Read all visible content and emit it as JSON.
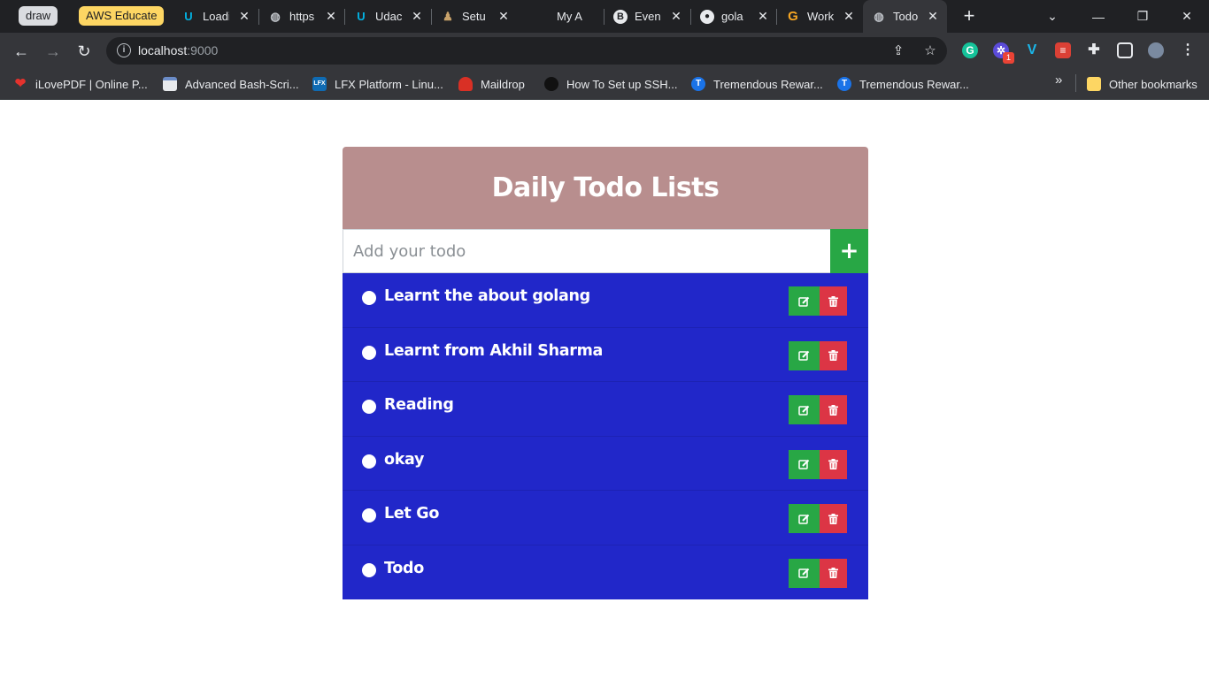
{
  "browser": {
    "tab_groups": [
      {
        "label": "draw",
        "color": "#dadce0"
      },
      {
        "label": "AWS Educate",
        "color": "#fdd663"
      }
    ],
    "tabs": [
      {
        "title": "Loadi",
        "icon": "udacity-icon"
      },
      {
        "title": "https",
        "icon": "globe-icon"
      },
      {
        "title": "Udac",
        "icon": "udacity-icon"
      },
      {
        "title": "Setu",
        "icon": "page-icon"
      },
      {
        "title": "My A",
        "icon": "blank-icon"
      },
      {
        "title": "Even",
        "icon": "b-logo-icon"
      },
      {
        "title": "gola",
        "icon": "github-icon"
      },
      {
        "title": "Work",
        "icon": "g-logo-icon"
      },
      {
        "title": "Todo",
        "icon": "globe-icon",
        "active": true
      }
    ],
    "address": {
      "host": "localhost",
      "port": ":9000"
    },
    "bookmarks": [
      {
        "label": "iLovePDF | Online P...",
        "icon": "heart-icon",
        "color": "#e5322d"
      },
      {
        "label": "Advanced Bash-Scri...",
        "icon": "page-icon",
        "color": "#6b8cc7"
      },
      {
        "label": "LFX Platform - Linu...",
        "icon": "lfx-icon",
        "color": "#0f6bb3"
      },
      {
        "label": "Maildrop",
        "icon": "mail-icon",
        "color": "#d93025"
      },
      {
        "label": "How To Set up SSH...",
        "icon": "penguin-icon",
        "color": "#444"
      },
      {
        "label": "Tremendous Rewar...",
        "icon": "tremendous-icon",
        "color": "#1a73e8"
      },
      {
        "label": "Tremendous Rewar...",
        "icon": "tremendous-icon",
        "color": "#1a73e8"
      }
    ],
    "other_bookmarks": "Other bookmarks",
    "extension_badge": "1"
  },
  "app": {
    "title": "Daily Todo Lists",
    "input_placeholder": "Add your todo",
    "add_symbol": "+",
    "colors": {
      "header": "#b88e8e",
      "list": "#2127c9",
      "add": "#28a745",
      "edit": "#28a745",
      "delete": "#dc3545"
    },
    "todos": [
      {
        "text": "Learnt the about golang"
      },
      {
        "text": "Learnt from Akhil Sharma"
      },
      {
        "text": "Reading"
      },
      {
        "text": "okay"
      },
      {
        "text": "Let Go"
      },
      {
        "text": "Todo"
      }
    ]
  }
}
